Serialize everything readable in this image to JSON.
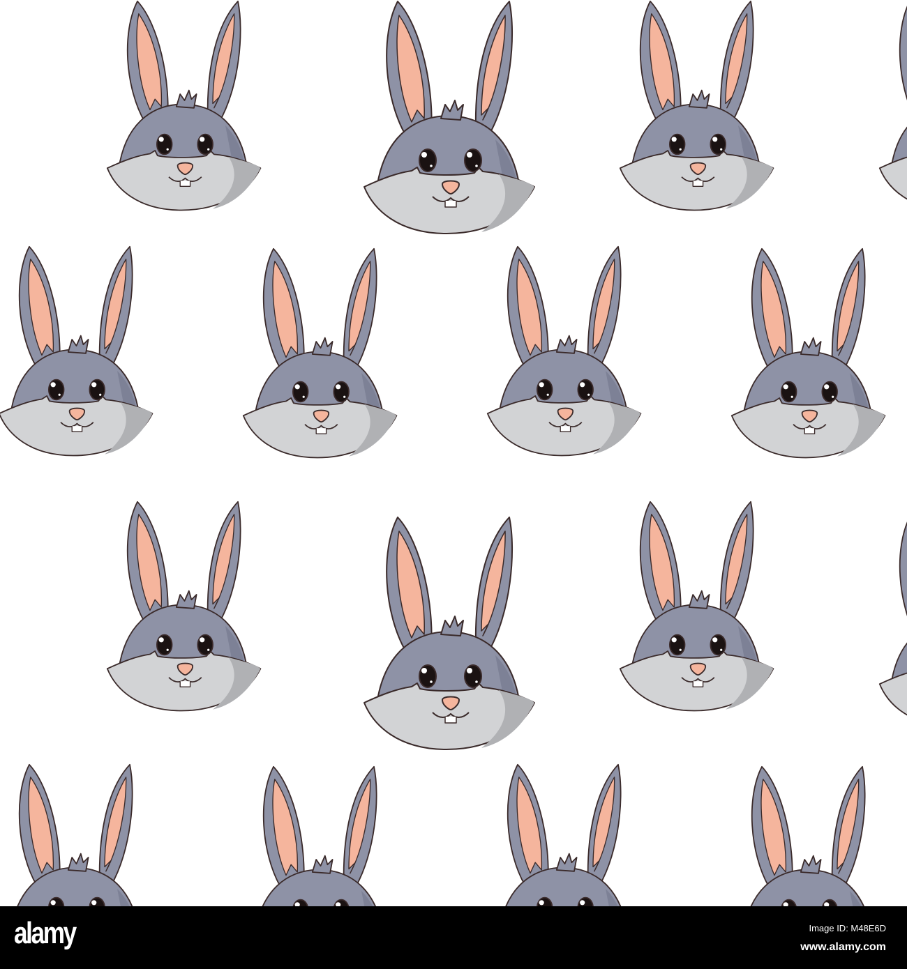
{
  "image": {
    "subject": "bunny-face-seamless-pattern"
  },
  "watermark": {
    "logo": "alamy",
    "image_id": "Image ID: M48E6D",
    "website": "www.alamy.com"
  },
  "colors": {
    "background": "#ffffff",
    "fur": "#8e92a6",
    "cheek": "#d2d3d5",
    "cheek_shadow": "#b0b1b4",
    "ear_inner": "#f5b59d",
    "outline": "#3a2a2a",
    "footer": "#000000"
  }
}
